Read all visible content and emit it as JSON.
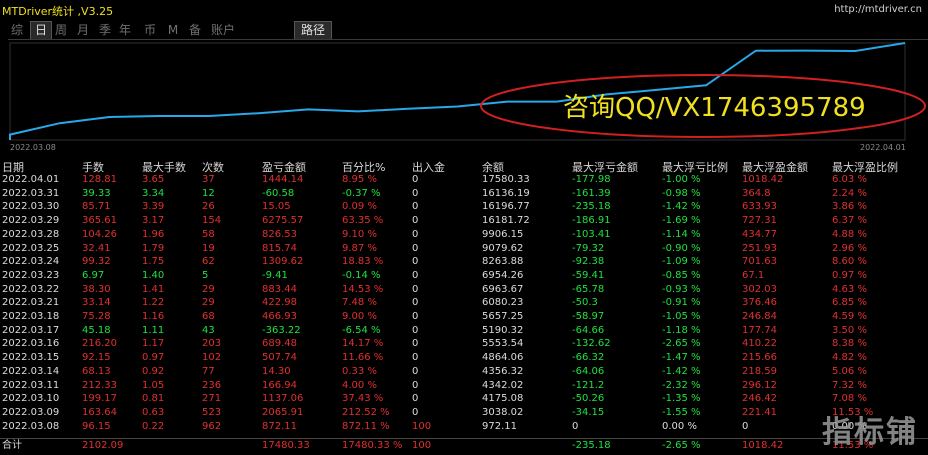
{
  "window": {
    "title": "MTDriver统计 ,V3.25",
    "link": "http://mtdriver.cn"
  },
  "tabs": [
    {
      "label": "综",
      "active": false
    },
    {
      "label": "日",
      "active": true
    },
    {
      "label": "周",
      "active": false
    },
    {
      "label": "月",
      "active": false
    },
    {
      "label": "季",
      "active": false
    },
    {
      "label": "年",
      "active": false
    },
    {
      "label": "币",
      "active": false
    },
    {
      "label": "M",
      "active": false
    },
    {
      "label": "备",
      "active": false
    },
    {
      "label": "账户",
      "active": false
    }
  ],
  "path_button": "路径",
  "chart_data": {
    "type": "line",
    "x": [
      "2022.03.08",
      "2022.03.09",
      "2022.03.10",
      "2022.03.11",
      "2022.03.14",
      "2022.03.15",
      "2022.03.16",
      "2022.03.17",
      "2022.03.18",
      "2022.03.21",
      "2022.03.22",
      "2022.03.23",
      "2022.03.24",
      "2022.03.25",
      "2022.03.28",
      "2022.03.29",
      "2022.03.30",
      "2022.03.31",
      "2022.04.01"
    ],
    "series": [
      {
        "values": [
          972.11,
          3038.02,
          4175.08,
          4342.02,
          4356.32,
          4864.06,
          5553.54,
          5190.32,
          5657.25,
          6080.23,
          6963.67,
          6954.26,
          8263.88,
          9079.62,
          9906.15,
          16181.72,
          16196.77,
          16136.19,
          17580.33
        ]
      }
    ],
    "x_start_label": "2022.03.08",
    "x_end_label": "2022.04.01",
    "line_color": "#28a8e8"
  },
  "annotation": "咨询QQ/VX1746395789",
  "columns": [
    "日期",
    "手数",
    "最大手数",
    "次数",
    "盈亏金额",
    "百分比%",
    "出入金",
    "余额",
    "最大浮亏金额",
    "最大浮亏比例",
    "最大浮盈金额",
    "最大浮盈比例"
  ],
  "rows": [
    {
      "c": [
        "2022.04.01",
        "128.81",
        "3.65",
        "37",
        "1444.14",
        "8.95 %",
        "0",
        "17580.33",
        "-177.98",
        "-1.00 %",
        "1018.42",
        "6.03 %"
      ],
      "s": "r"
    },
    {
      "c": [
        "2022.03.31",
        "39.33",
        "3.34",
        "12",
        "-60.58",
        "-0.37 %",
        "0",
        "16136.19",
        "-161.39",
        "-0.98 %",
        "364.8",
        "2.24 %"
      ],
      "s": "g"
    },
    {
      "c": [
        "2022.03.30",
        "85.71",
        "3.39",
        "26",
        "15.05",
        "0.09 %",
        "0",
        "16196.77",
        "-235.18",
        "-1.42 %",
        "633.93",
        "3.86 %"
      ],
      "s": "r"
    },
    {
      "c": [
        "2022.03.29",
        "365.61",
        "3.17",
        "154",
        "6275.57",
        "63.35 %",
        "0",
        "16181.72",
        "-186.91",
        "-1.69 %",
        "727.31",
        "6.37 %"
      ],
      "s": "r"
    },
    {
      "c": [
        "2022.03.28",
        "104.26",
        "1.96",
        "58",
        "826.53",
        "9.10 %",
        "0",
        "9906.15",
        "-103.41",
        "-1.14 %",
        "434.77",
        "4.88 %"
      ],
      "s": "r"
    },
    {
      "c": [
        "2022.03.25",
        "32.41",
        "1.79",
        "19",
        "815.74",
        "9.87 %",
        "0",
        "9079.62",
        "-79.32",
        "-0.90 %",
        "251.93",
        "2.96 %"
      ],
      "s": "r"
    },
    {
      "c": [
        "2022.03.24",
        "99.32",
        "1.75",
        "62",
        "1309.62",
        "18.83 %",
        "0",
        "8263.88",
        "-92.38",
        "-1.09 %",
        "701.63",
        "8.60 %"
      ],
      "s": "r"
    },
    {
      "c": [
        "2022.03.23",
        "6.97",
        "1.40",
        "5",
        "-9.41",
        "-0.14 %",
        "0",
        "6954.26",
        "-59.41",
        "-0.85 %",
        "67.1",
        "0.97 %"
      ],
      "s": "g"
    },
    {
      "c": [
        "2022.03.22",
        "38.30",
        "1.41",
        "29",
        "883.44",
        "14.53 %",
        "0",
        "6963.67",
        "-65.78",
        "-0.93 %",
        "302.03",
        "4.63 %"
      ],
      "s": "r"
    },
    {
      "c": [
        "2022.03.21",
        "33.14",
        "1.22",
        "29",
        "422.98",
        "7.48 %",
        "0",
        "6080.23",
        "-50.3",
        "-0.91 %",
        "376.46",
        "6.85 %"
      ],
      "s": "r"
    },
    {
      "c": [
        "2022.03.18",
        "75.28",
        "1.16",
        "68",
        "466.93",
        "9.00 %",
        "0",
        "5657.25",
        "-58.97",
        "-1.05 %",
        "246.84",
        "4.59 %"
      ],
      "s": "r"
    },
    {
      "c": [
        "2022.03.17",
        "45.18",
        "1.11",
        "43",
        "-363.22",
        "-6.54 %",
        "0",
        "5190.32",
        "-64.66",
        "-1.18 %",
        "177.74",
        "3.50 %"
      ],
      "s": "g"
    },
    {
      "c": [
        "2022.03.16",
        "216.20",
        "1.17",
        "203",
        "689.48",
        "14.17 %",
        "0",
        "5553.54",
        "-132.62",
        "-2.65 %",
        "410.22",
        "8.38 %"
      ],
      "s": "r"
    },
    {
      "c": [
        "2022.03.15",
        "92.15",
        "0.97",
        "102",
        "507.74",
        "11.66 %",
        "0",
        "4864.06",
        "-66.32",
        "-1.47 %",
        "215.66",
        "4.82 %"
      ],
      "s": "r"
    },
    {
      "c": [
        "2022.03.14",
        "68.13",
        "0.92",
        "77",
        "14.30",
        "0.33 %",
        "0",
        "4356.32",
        "-64.06",
        "-1.42 %",
        "218.59",
        "5.06 %"
      ],
      "s": "r"
    },
    {
      "c": [
        "2022.03.11",
        "212.33",
        "1.05",
        "236",
        "166.94",
        "4.00 %",
        "0",
        "4342.02",
        "-121.2",
        "-2.32 %",
        "296.12",
        "7.32 %"
      ],
      "s": "r"
    },
    {
      "c": [
        "2022.03.10",
        "199.17",
        "0.81",
        "271",
        "1137.06",
        "37.43 %",
        "0",
        "4175.08",
        "-50.26",
        "-1.35 %",
        "246.42",
        "7.08 %"
      ],
      "s": "r"
    },
    {
      "c": [
        "2022.03.09",
        "163.64",
        "0.63",
        "523",
        "2065.91",
        "212.52 %",
        "0",
        "3038.02",
        "-34.15",
        "-1.55 %",
        "221.41",
        "11.53 %"
      ],
      "s": "r"
    },
    {
      "c": [
        "2022.03.08",
        "96.15",
        "0.22",
        "962",
        "872.11",
        "872.11 %",
        "100",
        "972.11",
        "0",
        "0.00 %",
        "0",
        "0.00 %"
      ],
      "s": "r"
    }
  ],
  "total": {
    "c": [
      "合计",
      "2102.09",
      "",
      "",
      "17480.33",
      "17480.33 %",
      "100",
      "",
      "-235.18",
      "-2.65 %",
      "1018.42",
      "11.53 %"
    ]
  },
  "watermark": "指标铺",
  "colors": {
    "positive": "#e03030",
    "negative": "#20e040",
    "accent": "#f0e020",
    "annotation_ellipse": "#d02020",
    "annotation_text": "#f0e020"
  }
}
